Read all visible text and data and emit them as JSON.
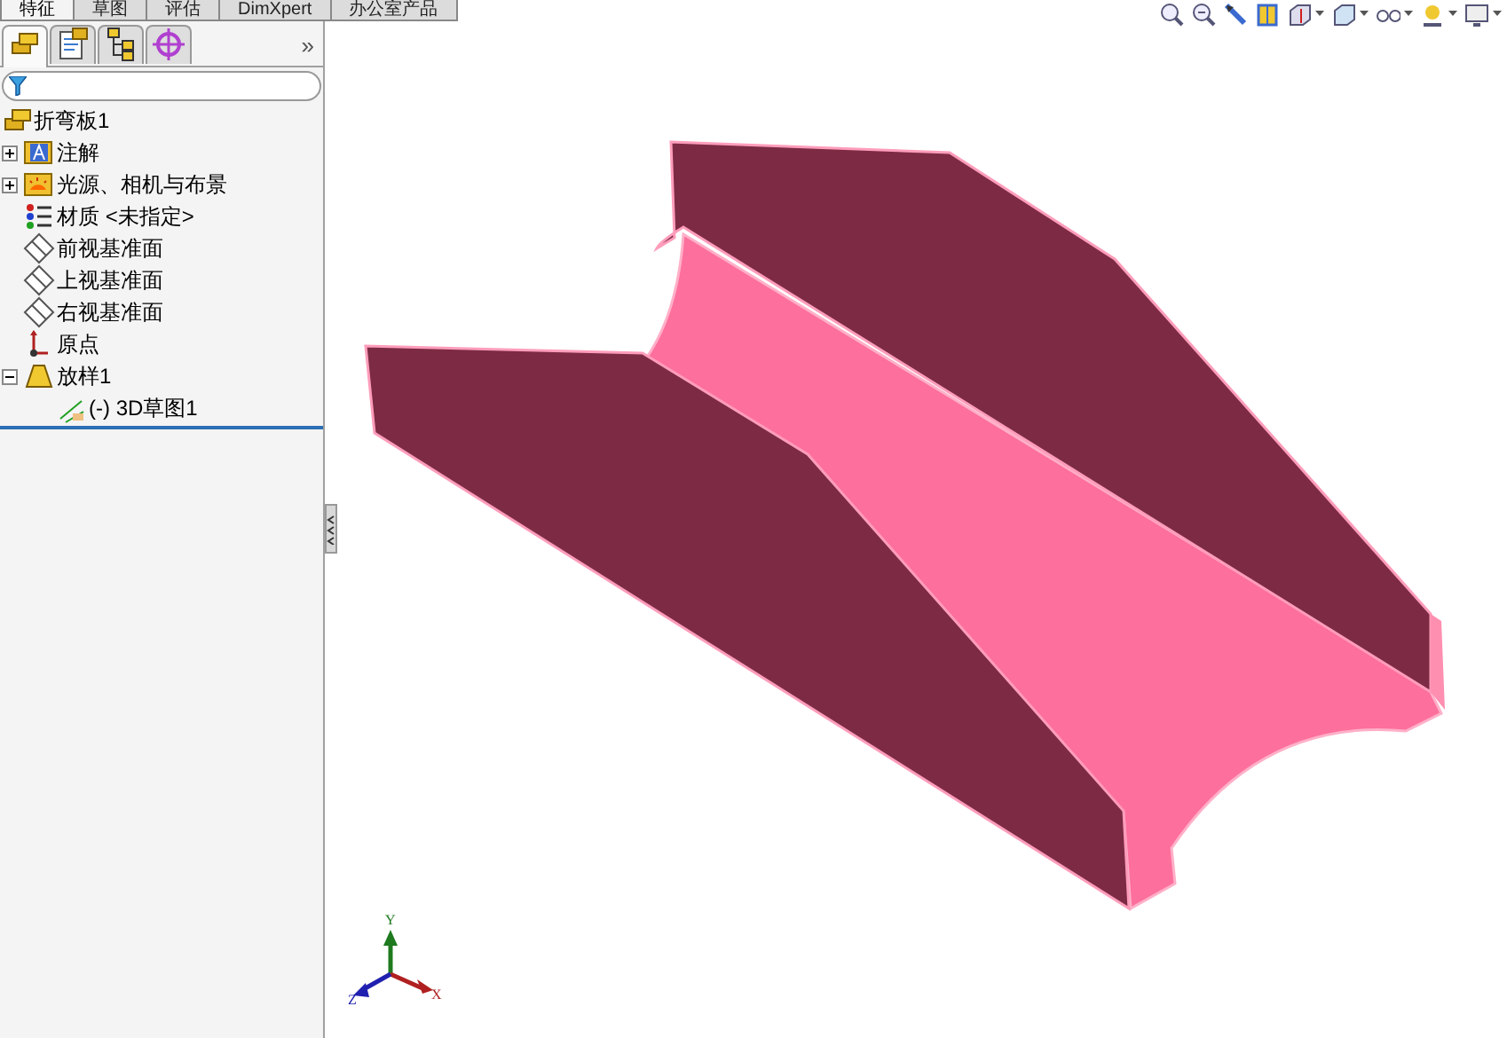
{
  "command_tabs": [
    {
      "label": "特征",
      "selected": true
    },
    {
      "label": "草图",
      "selected": false
    },
    {
      "label": "评估",
      "selected": false
    },
    {
      "label": "DimXpert",
      "selected": false
    },
    {
      "label": "办公室产品",
      "selected": false
    }
  ],
  "panel_tabs": [
    {
      "kind": "feature-manager",
      "selected": true
    },
    {
      "kind": "property-manager",
      "selected": false
    },
    {
      "kind": "configuration-manager",
      "selected": false
    },
    {
      "kind": "dim-xpert",
      "selected": false
    }
  ],
  "panel_more": "»",
  "tree": {
    "label": "折弯板1",
    "kind": "part",
    "children": [
      {
        "label": "注解",
        "kind": "annotations",
        "expanded": false
      },
      {
        "label": "光源、相机与布景",
        "kind": "lights",
        "expanded": false
      },
      {
        "label": "材质 <未指定>",
        "kind": "material"
      },
      {
        "label": "前视基准面",
        "kind": "plane"
      },
      {
        "label": "上视基准面",
        "kind": "plane"
      },
      {
        "label": "右视基准面",
        "kind": "plane"
      },
      {
        "label": "原点",
        "kind": "origin"
      },
      {
        "label": "放样1",
        "kind": "loft",
        "expanded": true,
        "children": [
          {
            "label": "(-) 3D草图1",
            "kind": "sketch3d"
          }
        ]
      }
    ]
  },
  "triad": {
    "x": "X",
    "y": "Y",
    "z": "Z"
  }
}
